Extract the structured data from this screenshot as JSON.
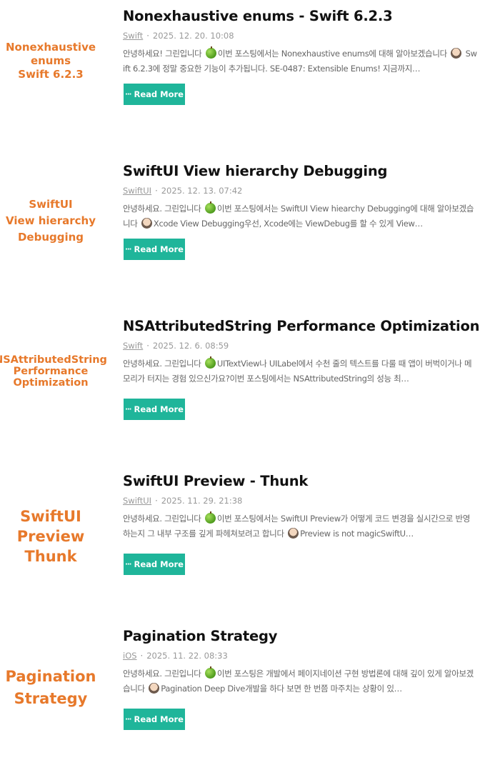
{
  "posts": [
    {
      "thumb": "Nonexhaustive\nenums\nSwift 6.2.3",
      "title": "Nonexhaustive enums - Swift 6.2.3",
      "category": "Swift",
      "date": "2025. 12. 20. 10:08",
      "excerpt_a": "안녕하세요! 그린입니다 ",
      "excerpt_b": "이번 포스팅에서는 Nonexhaustive enums에 대해 알아보겠습니다 ",
      "excerpt_c": " Swift 6.2.3에 정말 중요한 기능이 추가됩니다. SE-0487: Extensible Enums! 지금까지…",
      "read_more": "Read More"
    },
    {
      "thumb": "SwiftUI\nView hierarchy\nDebugging",
      "title": "SwiftUI View hierarchy Debugging",
      "category": "SwiftUI",
      "date": "2025. 12. 13. 07:42",
      "excerpt_a": "안녕하세요. 그린입니다 ",
      "excerpt_b": "이번 포스팅에서는 SwiftUI View hiearchy Debugging에 대해 알아보겠습니다 ",
      "excerpt_c": "Xcode View Debugging우선, Xcode에는 ViewDebug를 할 수 있게 View…",
      "read_more": "Read More"
    },
    {
      "thumb": "NSAttributedString\nPerformance\nOptimization",
      "title": "NSAttributedString Performance Optimization",
      "category": "Swift",
      "date": "2025. 12. 6. 08:59",
      "excerpt_a": "안녕하세요. 그린입니다 ",
      "excerpt_b": "UITextView나 UILabel에서 수천 줄의 텍스트를 다룰 때 앱이 버벅이거나 메모리가 터지는 경험 있으신가요?이번 포스팅에서는 NSAttributedString의 성능 최…",
      "excerpt_c": "",
      "read_more": "Read More"
    },
    {
      "thumb": "SwiftUI\nPreview\nThunk",
      "title": "SwiftUI Preview - Thunk",
      "category": "SwiftUI",
      "date": "2025. 11. 29. 21:38",
      "excerpt_a": "안녕하세요. 그린입니다 ",
      "excerpt_b": "이번 포스팅에서는 SwiftUI Preview가 어떻게 코드 변경을 실시간으로 반영하는지 그 내부 구조를 깊게 파헤쳐보려고 합니다 ",
      "excerpt_c": "Preview is not magicSwiftU…",
      "read_more": "Read More"
    },
    {
      "thumb": "Pagination\nStrategy",
      "title": "Pagination Strategy",
      "category": "iOS",
      "date": "2025. 11. 22. 08:33",
      "excerpt_a": "안녕하세요. 그린입니다 ",
      "excerpt_b": "이번 포스팅은 개발에서 페이지네이션 구현 방법론에 대해 깊이 있게 알아보겠습니다 ",
      "excerpt_c": "Pagination Deep Dive개발을 하다 보면 한 번쯤 마주치는 상황이 있…",
      "read_more": "Read More"
    }
  ],
  "icons": {
    "read_more": "ellipsis-icon",
    "emoji_1": "green-apple-emoji",
    "emoji_2": "person-emoji"
  },
  "colors": {
    "accent": "#1fb59a",
    "thumb_text": "#e7792b"
  }
}
